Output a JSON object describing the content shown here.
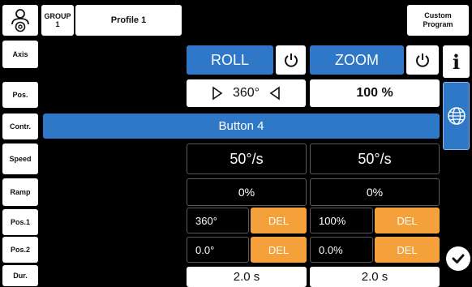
{
  "header": {
    "group_line1": "GROUP",
    "group_line2": "1",
    "profile": "Profile 1",
    "custom_line1": "Custom",
    "custom_line2": "Program"
  },
  "rows": {
    "axis": "Axis",
    "pos": "Pos.",
    "contr": "Contr.",
    "speed": "Speed",
    "ramp": "Ramp",
    "pos1": "Pos.1",
    "pos2": "Pos.2",
    "dur": "Dur."
  },
  "roll": {
    "title": "ROLL",
    "position": "360°",
    "speed": "50°/s",
    "ramp": "0%",
    "pos1": "360°",
    "pos1_del": "DEL",
    "pos2": "0.0°",
    "pos2_del": "DEL",
    "duration": "2.0 s"
  },
  "zoom": {
    "title": "ZOOM",
    "position": "100 %",
    "speed": "50°/s",
    "ramp": "0%",
    "pos1": "100%",
    "pos1_del": "DEL",
    "pos2": "0.0%",
    "pos2_del": "DEL",
    "duration": "2.0 s"
  },
  "controller": "Button 4",
  "info_symbol": "i",
  "colors": {
    "accent_blue": "#2f78c8",
    "del_orange": "#f4a13b",
    "background": "#000000"
  }
}
